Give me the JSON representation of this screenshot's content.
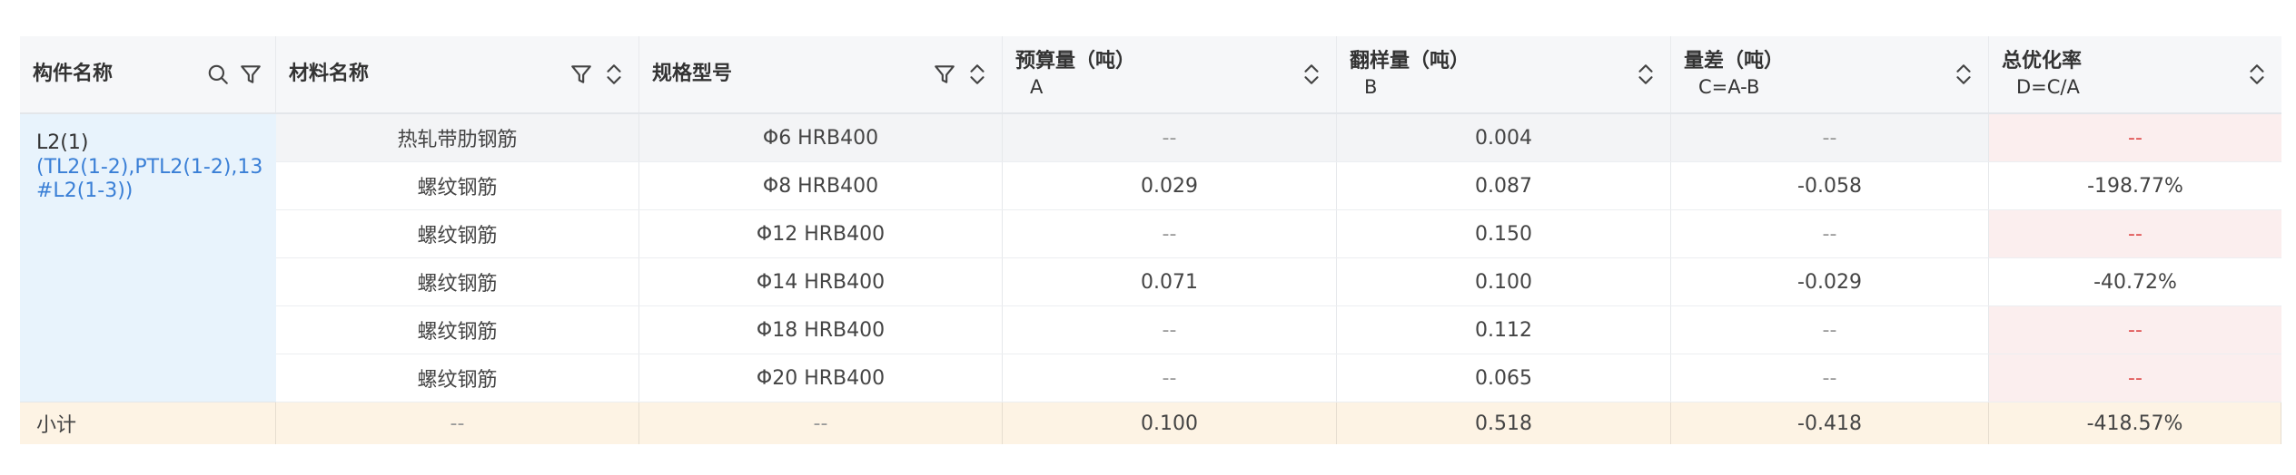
{
  "headers": [
    {
      "label": "构件名称",
      "sub": "",
      "icons": [
        "search-icon",
        "filter-icon"
      ]
    },
    {
      "label": "材料名称",
      "sub": "",
      "icons": [
        "filter-icon",
        "sort-icon"
      ]
    },
    {
      "label": "规格型号",
      "sub": "",
      "icons": [
        "filter-icon",
        "sort-icon"
      ]
    },
    {
      "label": "预算量（吨）",
      "sub": "A",
      "icons": [
        "sort-icon"
      ]
    },
    {
      "label": "翻样量（吨）",
      "sub": "B",
      "icons": [
        "sort-icon"
      ]
    },
    {
      "label": "量差（吨）",
      "sub": "C=A-B",
      "icons": [
        "sort-icon"
      ]
    },
    {
      "label": "总优化率",
      "sub": "D=C/A",
      "icons": [
        "sort-icon"
      ]
    }
  ],
  "component": {
    "name": "L2(1)",
    "detail": "(TL2(1-2),PTL2(1-2),13#L2(1-3))"
  },
  "rows": [
    {
      "material": "热轧带肋钢筋",
      "spec": "Φ6 HRB400",
      "budget": "--",
      "layout": "0.004",
      "diff": "--",
      "rate": "--"
    },
    {
      "material": "螺纹钢筋",
      "spec": "Φ8 HRB400",
      "budget": "0.029",
      "layout": "0.087",
      "diff": "-0.058",
      "rate": "-198.77%"
    },
    {
      "material": "螺纹钢筋",
      "spec": "Φ12 HRB400",
      "budget": "--",
      "layout": "0.150",
      "diff": "--",
      "rate": "--"
    },
    {
      "material": "螺纹钢筋",
      "spec": "Φ14 HRB400",
      "budget": "0.071",
      "layout": "0.100",
      "diff": "-0.029",
      "rate": "-40.72%"
    },
    {
      "material": "螺纹钢筋",
      "spec": "Φ18 HRB400",
      "budget": "--",
      "layout": "0.112",
      "diff": "--",
      "rate": "--"
    },
    {
      "material": "螺纹钢筋",
      "spec": "Φ20 HRB400",
      "budget": "--",
      "layout": "0.065",
      "diff": "--",
      "rate": "--"
    }
  ],
  "subtotal": {
    "label": "小计",
    "material": "--",
    "spec": "--",
    "budget": "0.100",
    "layout": "0.518",
    "diff": "-0.418",
    "rate": "-418.57%"
  },
  "colors": {
    "component_bg": "#e8f3fc",
    "component_link": "#3a7fd6",
    "subtotal_bg": "#fdf3e4",
    "empty_rate_bg": "#fbeeee",
    "empty_rate_text": "#e05454"
  }
}
